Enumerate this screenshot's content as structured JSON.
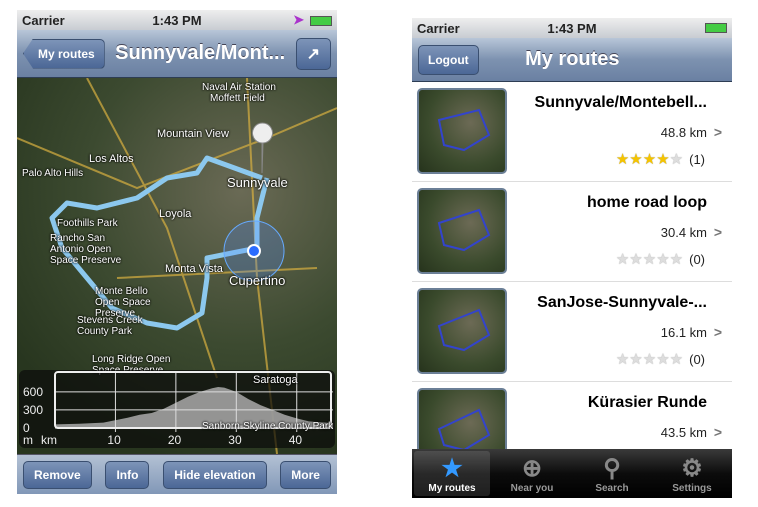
{
  "left": {
    "status": {
      "carrier": "Carrier",
      "time": "1:43 PM"
    },
    "nav": {
      "back": "My routes",
      "title": "Sunnyvale/Mont...",
      "action_icon": "share-icon"
    },
    "map_labels": [
      "Naval Air Station",
      "Moffett Field",
      "Mountain View",
      "Los Altos",
      "Sunnyvale",
      "Loyola",
      "Cupertino",
      "Monta Vista",
      "Rancho San Antonio Open Space Preserve",
      "Monte Bello Open Space Preserve",
      "Stevens Creek County Park",
      "Long Ridge Open Space Preserve",
      "Palo Alto Hills",
      "Foothills Park",
      "Saratoga",
      "Sanborn-Skyline County Park"
    ],
    "elevation": {
      "y_unit": "m",
      "x_unit": "km",
      "y_ticks": [
        0,
        300,
        600
      ],
      "x_ticks": [
        10,
        20,
        30,
        40
      ],
      "ylim": [
        0,
        930
      ],
      "xlim": [
        0,
        46
      ],
      "profile_km": [
        0,
        4,
        8,
        12,
        14,
        16,
        18,
        20,
        22,
        24,
        26,
        27,
        28,
        30,
        32,
        34,
        36,
        38,
        40,
        42,
        46
      ],
      "profile_m": [
        60,
        70,
        90,
        170,
        220,
        250,
        320,
        420,
        520,
        600,
        660,
        680,
        670,
        600,
        480,
        380,
        300,
        220,
        160,
        110,
        80
      ]
    },
    "toolbar": {
      "remove": "Remove",
      "info": "Info",
      "hide_elevation": "Hide elevation",
      "more": "More"
    }
  },
  "right": {
    "status": {
      "carrier": "Carrier",
      "time": "1:43 PM"
    },
    "nav": {
      "logout": "Logout",
      "title": "My routes"
    },
    "routes": [
      {
        "title": "Sunnyvale/Montebell...",
        "distance": "48.8 km",
        "rating": 4,
        "count": "(1)"
      },
      {
        "title": "home road loop",
        "distance": "30.4 km",
        "rating": 0,
        "count": "(0)"
      },
      {
        "title": "SanJose-Sunnyvale-...",
        "distance": "16.1 km",
        "rating": 0,
        "count": "(0)"
      },
      {
        "title": "Kürasier Runde",
        "distance": "43.5 km",
        "rating": null,
        "count": null
      }
    ],
    "tabs": [
      {
        "label": "My routes",
        "icon": "star-icon"
      },
      {
        "label": "Near you",
        "icon": "crosshair-icon"
      },
      {
        "label": "Search",
        "icon": "search-icon"
      },
      {
        "label": "Settings",
        "icon": "gear-icon"
      }
    ]
  }
}
